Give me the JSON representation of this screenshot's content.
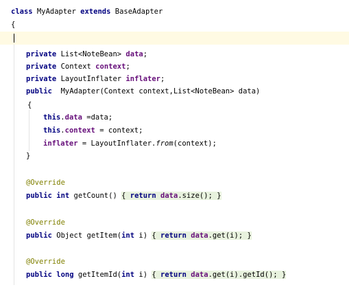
{
  "code": {
    "l1": {
      "kw": "class",
      "name": " MyAdapter ",
      "kw2": "extends",
      "base": " BaseAdapter"
    },
    "l2": {
      "text": "{"
    },
    "l4": {
      "kw": "private",
      "type": " List<NoteBean> ",
      "field": "data",
      "end": ";"
    },
    "l5": {
      "kw": "private",
      "type": " Context ",
      "field": "context",
      "end": ";"
    },
    "l6": {
      "kw": "private",
      "type": " LayoutInflater ",
      "field": "inflater",
      "end": ";"
    },
    "l7": {
      "kw": "public",
      "rest": "  MyAdapter(Context context,List<NoteBean> data)"
    },
    "l8": {
      "text": "{"
    },
    "l9": {
      "kw": "this",
      "dot": ".",
      "field": "data",
      "rest": " =data;"
    },
    "l10": {
      "kw": "this",
      "dot": ".",
      "field": "context",
      "rest": " = context;"
    },
    "l11": {
      "field": "inflater",
      "mid": " = LayoutInflater.",
      "italic": "from",
      "rest": "(context);"
    },
    "l12": {
      "text": "}"
    },
    "l14": {
      "ann": "@Override"
    },
    "l15": {
      "kw": "public",
      "kw2": " int",
      "rest": " getCount() ",
      "b1": "{",
      "kw3": " return",
      "sp": " ",
      "field": "data",
      "rest2": ".size(); ",
      "b2": "}"
    },
    "l17": {
      "ann": "@Override"
    },
    "l18": {
      "kw": "public",
      "rest": " Object getItem(",
      "kw2": "int",
      "rest2": " i) ",
      "b1": "{",
      "kw3": " return",
      "sp": " ",
      "field": "data",
      "rest3": ".get(i); ",
      "b2": "}"
    },
    "l20": {
      "ann": "@Override"
    },
    "l21": {
      "kw": "public",
      "kw2": " long",
      "rest": " getItemId(",
      "kw3": "int",
      "rest2": " i) ",
      "b1": "{",
      "kw4": " return",
      "sp": " ",
      "field": "data",
      "rest3": ".get(i).getId(); ",
      "b2": "}"
    }
  }
}
